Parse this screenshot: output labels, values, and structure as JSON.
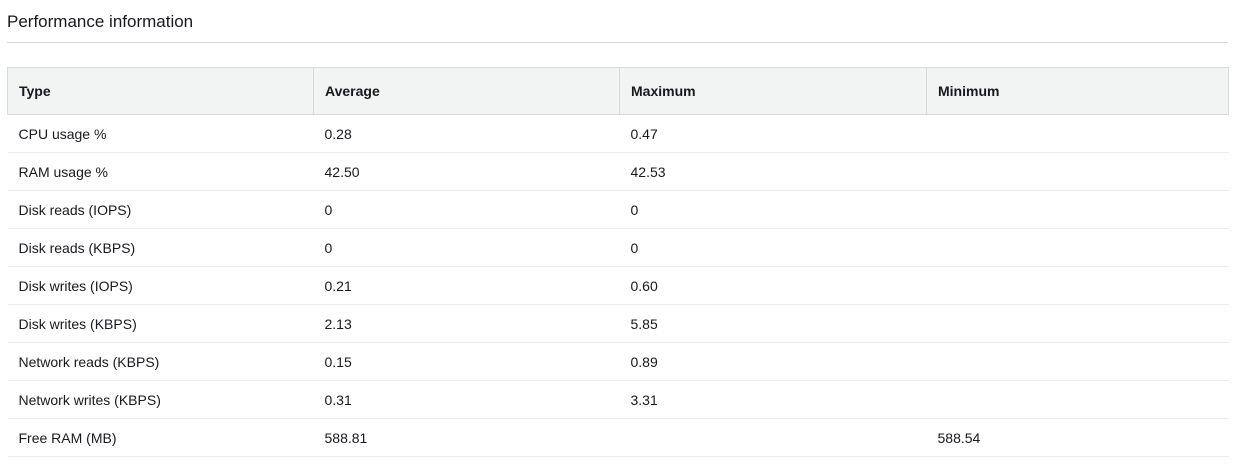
{
  "section": {
    "title": "Performance information"
  },
  "table": {
    "columns": [
      "Type",
      "Average",
      "Maximum",
      "Minimum"
    ],
    "rows": [
      [
        "CPU usage %",
        "0.28",
        "0.47",
        ""
      ],
      [
        "RAM usage %",
        "42.50",
        "42.53",
        ""
      ],
      [
        "Disk reads (IOPS)",
        "0",
        "0",
        ""
      ],
      [
        "Disk reads (KBPS)",
        "0",
        "0",
        ""
      ],
      [
        "Disk writes (IOPS)",
        "0.21",
        "0.60",
        ""
      ],
      [
        "Disk writes (KBPS)",
        "2.13",
        "5.85",
        ""
      ],
      [
        "Network reads (KBPS)",
        "0.15",
        "0.89",
        ""
      ],
      [
        "Network writes (KBPS)",
        "0.31",
        "3.31",
        ""
      ],
      [
        "Free RAM (MB)",
        "588.81",
        "",
        "588.54"
      ]
    ]
  }
}
